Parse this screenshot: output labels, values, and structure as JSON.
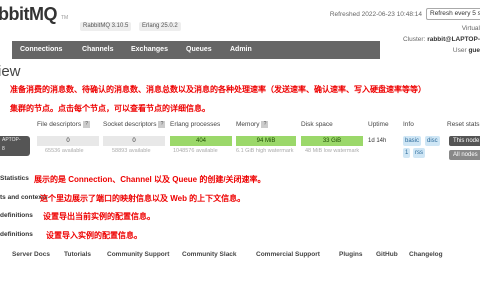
{
  "header": {
    "logo_main": "bbitMQ",
    "logo_tm": "TM",
    "rabbitmq_version": "RabbitMQ 3.10.5",
    "erlang_version": "Erlang 25.0.2",
    "refreshed": "Refreshed 2022-06-23 10:48:14",
    "refresh_select": "Refresh every 5 s",
    "virtual_host_label": "Virtual",
    "cluster_label": "Cluster:",
    "cluster_value": "rabbit@LAPTOP-",
    "user_label": "User",
    "user_value": "gue"
  },
  "nav": {
    "tabs": [
      "Connections",
      "Channels",
      "Exchanges",
      "Queues",
      "Admin"
    ]
  },
  "page": {
    "title": "iew"
  },
  "annotations": {
    "line1": "准备消费的消息数、待确认的消息数、消息总数以及消息的各种处理速率（发送速率、确认速率、写入硬盘速率等等）",
    "line2": "集群的节点。点击每个节点，可以查看节点的详细信息。",
    "line3": "展示的是 Connection、Channel 以及 Queue 的创建/关闭速率。",
    "line4": "这个里边展示了端口的映射信息以及 Web 的上下文信息。",
    "line5": "设置导出当前实例的配置信息。",
    "line6": "设置导入实例的配置信息。"
  },
  "nodes_table": {
    "headers": [
      "File descriptors",
      "Socket descriptors",
      "Erlang processes",
      "Memory",
      "Disk space",
      "Uptime",
      "Info",
      "Reset stats"
    ],
    "node_name": "APTOP-\n8",
    "file_desc": "0",
    "file_desc_sub": "65536 available",
    "socket_desc": "0",
    "socket_desc_sub": "58893 available",
    "erlang_proc": "404",
    "erlang_proc_sub": "1048576 available",
    "memory": "94 MiB",
    "memory_sub": "6.1 GiB high watermark",
    "disk": "33 GiB",
    "disk_sub": "48 MiB low watermark",
    "uptime": "1d 14h",
    "info_tags": [
      "basic",
      "disc",
      "1",
      "rss"
    ],
    "reset_btn_1": "This node",
    "reset_btn_2": "All nodes",
    "help": "?"
  },
  "sections": {
    "churn": "Statistics",
    "ports": "ts and contexts",
    "export": "definitions",
    "import": "definitions"
  },
  "footer": {
    "links": [
      "Server Docs",
      "Tutorials",
      "Community Support",
      "Community Slack",
      "Commercial Support",
      "Plugins",
      "GitHub",
      "Changelog"
    ]
  }
}
